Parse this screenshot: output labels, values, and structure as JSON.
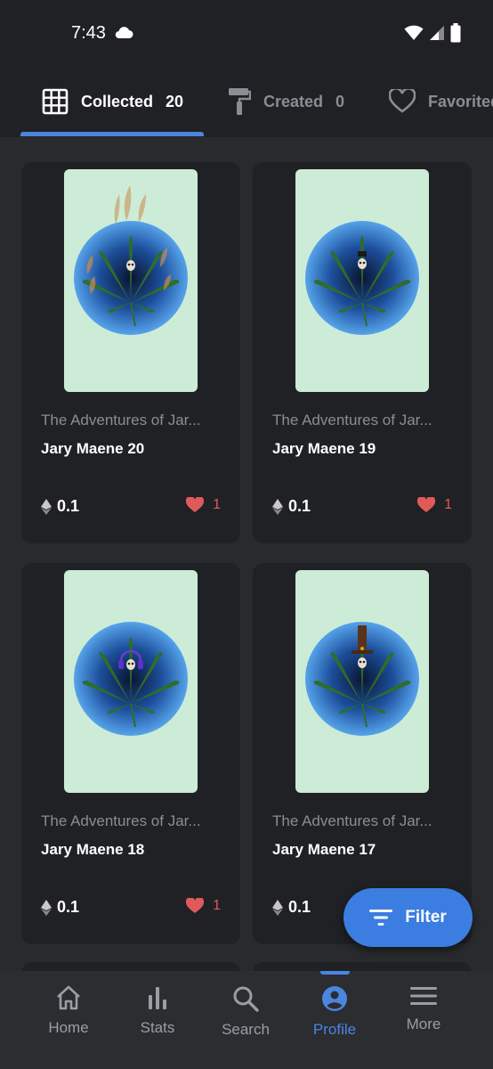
{
  "status_bar": {
    "time": "7:43",
    "icons": [
      "cloud-icon",
      "wifi-icon",
      "signal-icon",
      "battery-icon"
    ]
  },
  "tabs": [
    {
      "label": "Collected",
      "count": "20",
      "icon": "grid-icon",
      "active": true
    },
    {
      "label": "Created",
      "count": "0",
      "icon": "paint-roller-icon",
      "active": false
    },
    {
      "label": "Favorited",
      "count": "",
      "icon": "heart-outline-icon",
      "active": false
    }
  ],
  "cards": [
    {
      "collection": "The Adventures of Jar...",
      "name": "Jary Maene 20",
      "price": "0.1",
      "likes": "1",
      "art": "fire"
    },
    {
      "collection": "The Adventures of Jar...",
      "name": "Jary Maene 19",
      "price": "0.1",
      "likes": "1",
      "art": "hat"
    },
    {
      "collection": "The Adventures of Jar...",
      "name": "Jary Maene 18",
      "price": "0.1",
      "likes": "1",
      "art": "headphones"
    },
    {
      "collection": "The Adventures of Jar...",
      "name": "Jary Maene 17",
      "price": "0.1",
      "likes": "",
      "art": "tophat"
    }
  ],
  "filter_button": {
    "label": "Filter",
    "icon": "filter-icon"
  },
  "bottom_nav": [
    {
      "label": "Home",
      "icon": "home-icon",
      "active": false
    },
    {
      "label": "Stats",
      "icon": "stats-icon",
      "active": false
    },
    {
      "label": "Search",
      "icon": "search-icon",
      "active": false
    },
    {
      "label": "Profile",
      "icon": "profile-icon",
      "active": true
    },
    {
      "label": "More",
      "icon": "menu-icon",
      "active": false
    }
  ],
  "colors": {
    "background": "#202124",
    "accent": "#4a86e0",
    "like": "#e05a5a",
    "art_bg": "#cdecd7"
  }
}
